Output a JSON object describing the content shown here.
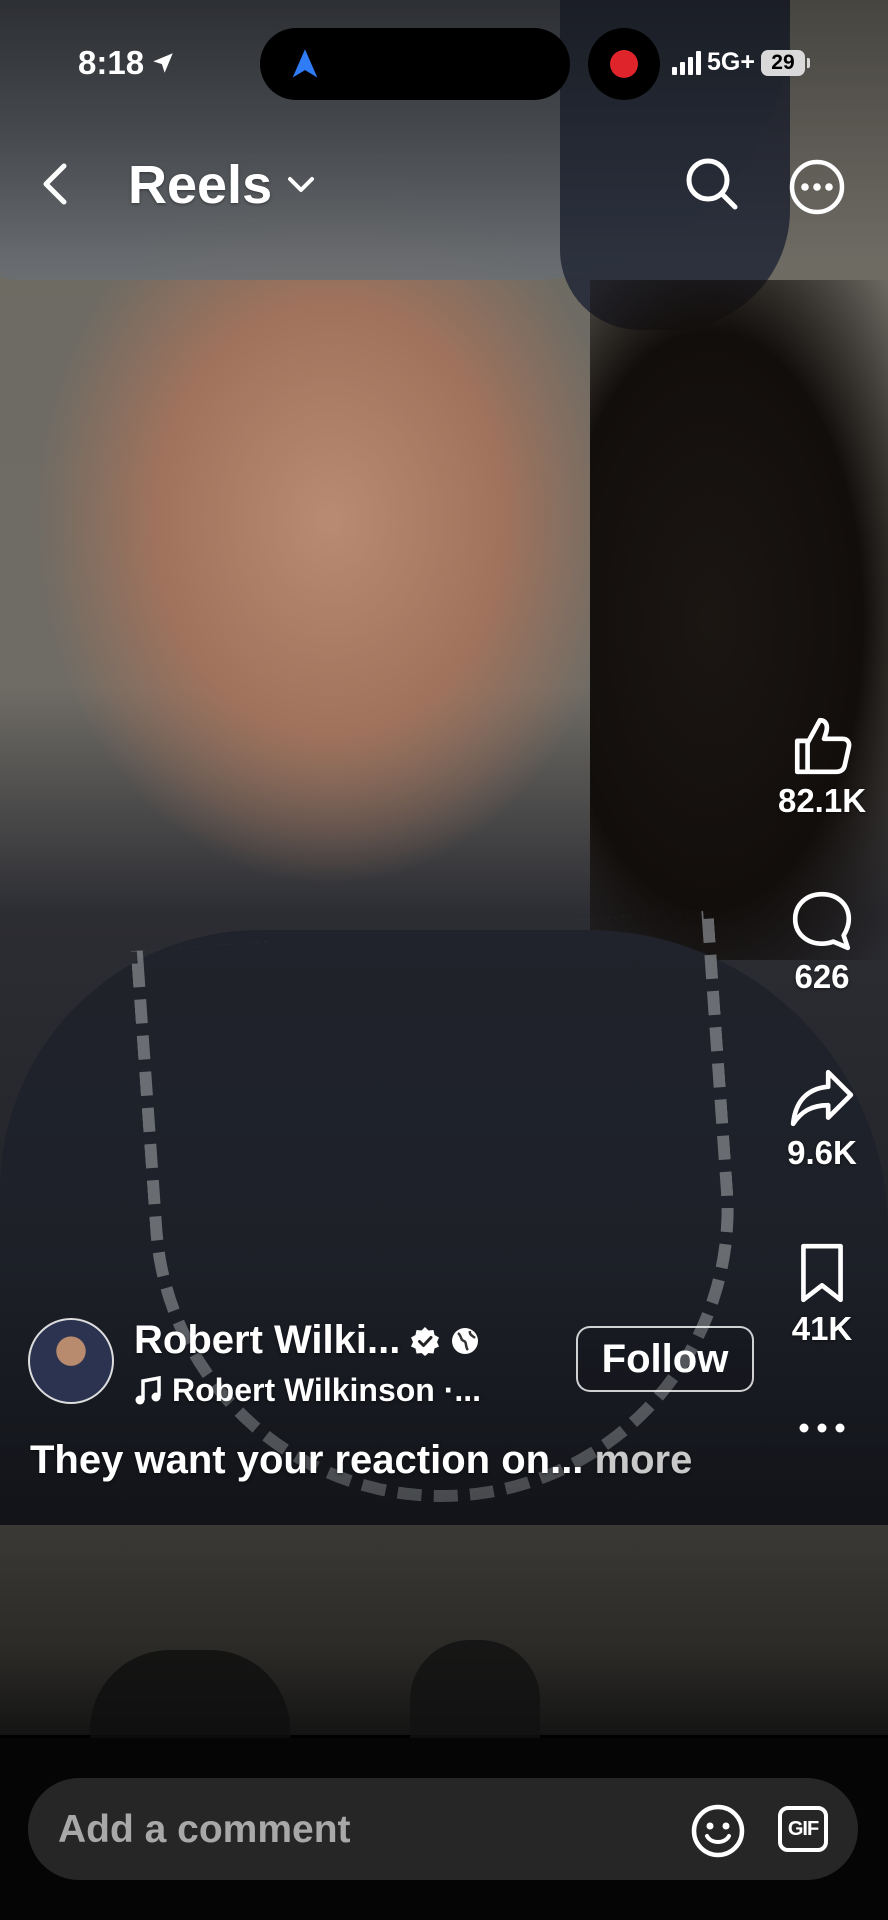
{
  "status_bar": {
    "time": "8:18",
    "network": "5G+",
    "battery": "29"
  },
  "header": {
    "title": "Reels",
    "back_icon": "chevron-left-icon",
    "search_icon": "search-icon",
    "more_icon": "more-horizontal-circle-icon"
  },
  "actions": {
    "likes": "82.1K",
    "comments": "626",
    "shares": "9.6K",
    "saves": "41K"
  },
  "post": {
    "username": "Robert Wilki...",
    "follow_label": "Follow",
    "audio": "Robert Wilkinson ·...",
    "caption": "They want your reaction on...",
    "more_label": "more"
  },
  "comment_bar": {
    "placeholder": "Add a comment",
    "gif_label": "GIF"
  },
  "colors": {
    "recording_dot": "#e0242b",
    "comment_pill": "#262626",
    "placeholder": "#a8a8a8"
  }
}
